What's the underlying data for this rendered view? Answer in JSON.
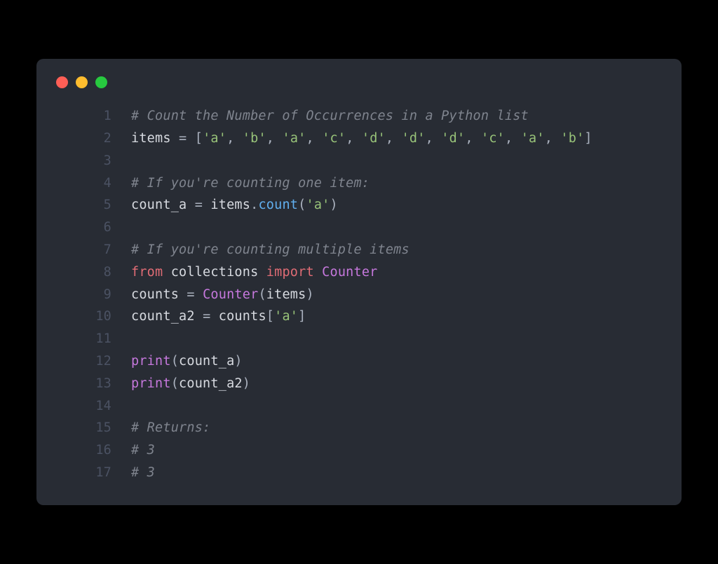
{
  "window": {
    "traffic_lights": [
      "close",
      "minimize",
      "zoom"
    ]
  },
  "code": {
    "language": "python",
    "lines": [
      {
        "n": 1,
        "tokens": [
          {
            "t": "# Count the Number of Occurrences in a Python list",
            "c": "comment"
          }
        ]
      },
      {
        "n": 2,
        "tokens": [
          {
            "t": "items",
            "c": "default"
          },
          {
            "t": " ",
            "c": "default"
          },
          {
            "t": "=",
            "c": "op"
          },
          {
            "t": " ",
            "c": "default"
          },
          {
            "t": "[",
            "c": "punc"
          },
          {
            "t": "'a'",
            "c": "string"
          },
          {
            "t": ", ",
            "c": "punc"
          },
          {
            "t": "'b'",
            "c": "string"
          },
          {
            "t": ", ",
            "c": "punc"
          },
          {
            "t": "'a'",
            "c": "string"
          },
          {
            "t": ", ",
            "c": "punc"
          },
          {
            "t": "'c'",
            "c": "string"
          },
          {
            "t": ", ",
            "c": "punc"
          },
          {
            "t": "'d'",
            "c": "string"
          },
          {
            "t": ", ",
            "c": "punc"
          },
          {
            "t": "'d'",
            "c": "string"
          },
          {
            "t": ", ",
            "c": "punc"
          },
          {
            "t": "'d'",
            "c": "string"
          },
          {
            "t": ", ",
            "c": "punc"
          },
          {
            "t": "'c'",
            "c": "string"
          },
          {
            "t": ", ",
            "c": "punc"
          },
          {
            "t": "'a'",
            "c": "string"
          },
          {
            "t": ", ",
            "c": "punc"
          },
          {
            "t": "'b'",
            "c": "string"
          },
          {
            "t": "]",
            "c": "punc"
          }
        ]
      },
      {
        "n": 3,
        "tokens": []
      },
      {
        "n": 4,
        "tokens": [
          {
            "t": "# If you're counting one item:",
            "c": "comment"
          }
        ]
      },
      {
        "n": 5,
        "tokens": [
          {
            "t": "count_a",
            "c": "default"
          },
          {
            "t": " ",
            "c": "default"
          },
          {
            "t": "=",
            "c": "op"
          },
          {
            "t": " ",
            "c": "default"
          },
          {
            "t": "items",
            "c": "default"
          },
          {
            "t": ".",
            "c": "punc"
          },
          {
            "t": "count",
            "c": "func"
          },
          {
            "t": "(",
            "c": "punc"
          },
          {
            "t": "'a'",
            "c": "string"
          },
          {
            "t": ")",
            "c": "punc"
          }
        ]
      },
      {
        "n": 6,
        "tokens": []
      },
      {
        "n": 7,
        "tokens": [
          {
            "t": "# If you're counting multiple items",
            "c": "comment"
          }
        ]
      },
      {
        "n": 8,
        "tokens": [
          {
            "t": "from",
            "c": "import"
          },
          {
            "t": " ",
            "c": "default"
          },
          {
            "t": "collections",
            "c": "default"
          },
          {
            "t": " ",
            "c": "default"
          },
          {
            "t": "import",
            "c": "import"
          },
          {
            "t": " ",
            "c": "default"
          },
          {
            "t": "Counter",
            "c": "keyword"
          }
        ]
      },
      {
        "n": 9,
        "tokens": [
          {
            "t": "counts",
            "c": "default"
          },
          {
            "t": " ",
            "c": "default"
          },
          {
            "t": "=",
            "c": "op"
          },
          {
            "t": " ",
            "c": "default"
          },
          {
            "t": "Counter",
            "c": "keyword"
          },
          {
            "t": "(",
            "c": "punc"
          },
          {
            "t": "items",
            "c": "default"
          },
          {
            "t": ")",
            "c": "punc"
          }
        ]
      },
      {
        "n": 10,
        "tokens": [
          {
            "t": "count_a2",
            "c": "default"
          },
          {
            "t": " ",
            "c": "default"
          },
          {
            "t": "=",
            "c": "op"
          },
          {
            "t": " ",
            "c": "default"
          },
          {
            "t": "counts",
            "c": "default"
          },
          {
            "t": "[",
            "c": "punc"
          },
          {
            "t": "'a'",
            "c": "string"
          },
          {
            "t": "]",
            "c": "punc"
          }
        ]
      },
      {
        "n": 11,
        "tokens": []
      },
      {
        "n": 12,
        "tokens": [
          {
            "t": "print",
            "c": "keyword"
          },
          {
            "t": "(",
            "c": "punc"
          },
          {
            "t": "count_a",
            "c": "default"
          },
          {
            "t": ")",
            "c": "punc"
          }
        ]
      },
      {
        "n": 13,
        "tokens": [
          {
            "t": "print",
            "c": "keyword"
          },
          {
            "t": "(",
            "c": "punc"
          },
          {
            "t": "count_a2",
            "c": "default"
          },
          {
            "t": ")",
            "c": "punc"
          }
        ]
      },
      {
        "n": 14,
        "tokens": []
      },
      {
        "n": 15,
        "tokens": [
          {
            "t": "# Returns:",
            "c": "comment"
          }
        ]
      },
      {
        "n": 16,
        "tokens": [
          {
            "t": "# 3",
            "c": "comment"
          }
        ]
      },
      {
        "n": 17,
        "tokens": [
          {
            "t": "# 3",
            "c": "comment"
          }
        ]
      }
    ]
  }
}
